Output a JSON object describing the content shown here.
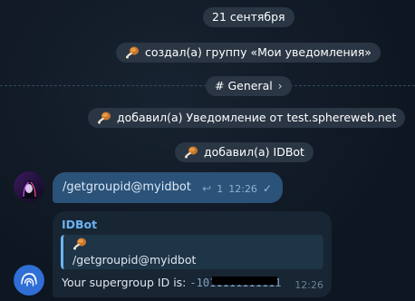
{
  "date_pill": "21 сентября",
  "events": {
    "created_group": "создал(а) группу «Мои уведомления»",
    "added_notification": "добавил(а) Уведомление от test.sphereweb.net",
    "added_idbot": "добавил(а) IDBot"
  },
  "topic": {
    "label": "# General",
    "chevron": "›"
  },
  "outgoing": {
    "text": "/getgroupid@myidbot",
    "reply_icon": "reply-icon",
    "reply_count": "1",
    "time": "12:26",
    "status": "✓"
  },
  "incoming": {
    "sender": "IDBot",
    "quote_text": "/getgroupid@myidbot",
    "result_prefix": "Your supergroup ID is: ",
    "result_id": "-1011111111111",
    "time": "12:26"
  },
  "colors": {
    "background": "#0e1621",
    "outgoing_bubble": "#2b5278",
    "incoming_bubble": "#182533",
    "accent": "#6ab3f3"
  }
}
